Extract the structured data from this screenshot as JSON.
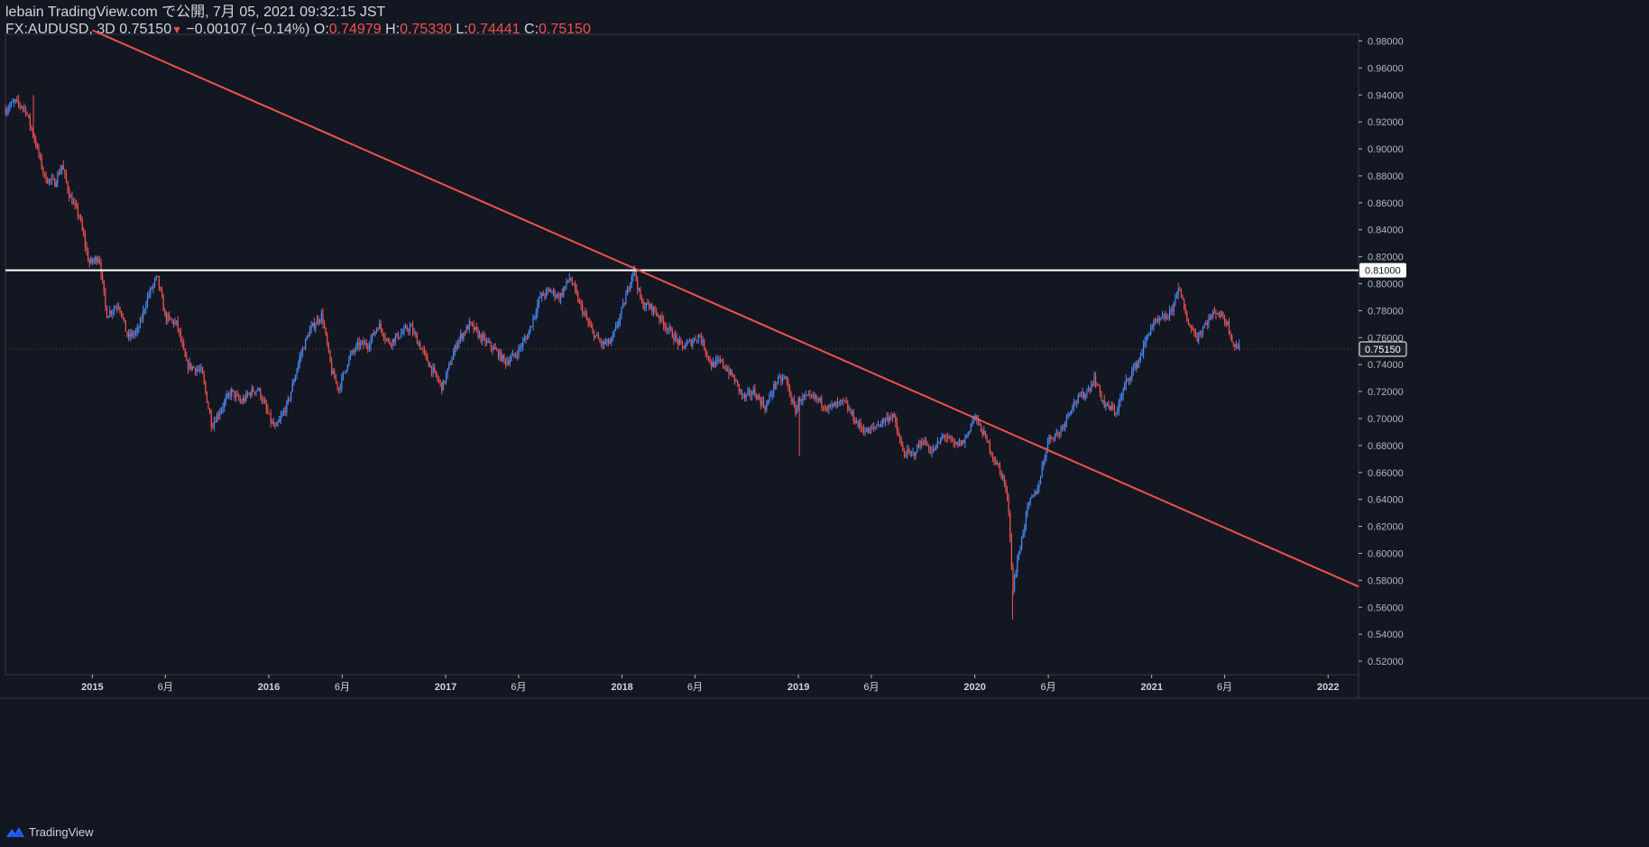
{
  "header": {
    "publish_line": "lebain TradingView.com で公開, 7月 05, 2021 09:32:15 JST",
    "symbol": "FX:AUDUSD, 3D",
    "last_price": "0.75150",
    "arrow": "▼",
    "change": "−0.00107 (−0.14%)",
    "o_label": "O:",
    "o_value": "0.74979",
    "h_label": "H:",
    "h_value": "0.75330",
    "l_label": "L:",
    "l_value": "0.74441",
    "c_label": "C:",
    "c_value": "0.75150"
  },
  "footer": {
    "brand": "TradingView",
    "logo_icon": "tradingview-logo-icon"
  },
  "colors": {
    "background": "#131722",
    "up": "#2962ff",
    "up_bright": "#4a8cf7",
    "down": "#ef5350",
    "trendline": "#f0524d",
    "level_line": "#ffffff",
    "axis_text": "#b2b5be",
    "border": "#363a45"
  },
  "chart_data": {
    "type": "candlestick",
    "title": "FX:AUDUSD, 3D",
    "ylim": [
      0.51,
      0.985
    ],
    "y_ticks": [
      "0.52000",
      "0.54000",
      "0.56000",
      "0.58000",
      "0.60000",
      "0.62000",
      "0.64000",
      "0.66000",
      "0.68000",
      "0.70000",
      "0.72000",
      "0.74000",
      "0.76000",
      "0.78000",
      "0.80000",
      "0.82000",
      "0.84000",
      "0.86000",
      "0.88000",
      "0.90000",
      "0.92000",
      "0.94000",
      "0.96000",
      "0.98000"
    ],
    "x_range": [
      "2014-07-05",
      "2022-03-05"
    ],
    "x_ticks": [
      {
        "label": "2015",
        "date": "2015-01-01",
        "bold": true
      },
      {
        "label": "6月",
        "date": "2015-06-01",
        "bold": false
      },
      {
        "label": "2016",
        "date": "2016-01-01",
        "bold": true
      },
      {
        "label": "6月",
        "date": "2016-06-01",
        "bold": false
      },
      {
        "label": "2017",
        "date": "2017-01-01",
        "bold": true
      },
      {
        "label": "6月",
        "date": "2017-06-01",
        "bold": false
      },
      {
        "label": "2018",
        "date": "2018-01-01",
        "bold": true
      },
      {
        "label": "6月",
        "date": "2018-06-01",
        "bold": false
      },
      {
        "label": "2019",
        "date": "2019-01-01",
        "bold": true
      },
      {
        "label": "6月",
        "date": "2019-06-01",
        "bold": false
      },
      {
        "label": "2020",
        "date": "2020-01-01",
        "bold": true
      },
      {
        "label": "6月",
        "date": "2020-06-01",
        "bold": false
      },
      {
        "label": "2021",
        "date": "2021-01-01",
        "bold": true
      },
      {
        "label": "6月",
        "date": "2021-06-01",
        "bold": false
      },
      {
        "label": "2022",
        "date": "2022-01-01",
        "bold": true
      }
    ],
    "price_path": [
      [
        "2014-07-05",
        0.929
      ],
      [
        "2014-07-25",
        0.935
      ],
      [
        "2014-08-15",
        0.93
      ],
      [
        "2014-09-05",
        0.905
      ],
      [
        "2014-09-25",
        0.878
      ],
      [
        "2014-10-15",
        0.875
      ],
      [
        "2014-10-30",
        0.888
      ],
      [
        "2014-11-15",
        0.865
      ],
      [
        "2014-12-05",
        0.85
      ],
      [
        "2014-12-25",
        0.815
      ],
      [
        "2015-01-15",
        0.82
      ],
      [
        "2015-01-30",
        0.777
      ],
      [
        "2015-02-25",
        0.785
      ],
      [
        "2015-03-15",
        0.76
      ],
      [
        "2015-04-05",
        0.765
      ],
      [
        "2015-04-25",
        0.79
      ],
      [
        "2015-05-15",
        0.805
      ],
      [
        "2015-06-01",
        0.775
      ],
      [
        "2015-06-25",
        0.77
      ],
      [
        "2015-07-15",
        0.74
      ],
      [
        "2015-08-15",
        0.735
      ],
      [
        "2015-09-05",
        0.695
      ],
      [
        "2015-09-25",
        0.708
      ],
      [
        "2015-10-15",
        0.72
      ],
      [
        "2015-11-05",
        0.712
      ],
      [
        "2015-11-25",
        0.72
      ],
      [
        "2015-12-10",
        0.722
      ],
      [
        "2016-01-05",
        0.698
      ],
      [
        "2016-01-15",
        0.692
      ],
      [
        "2016-02-10",
        0.712
      ],
      [
        "2016-03-05",
        0.745
      ],
      [
        "2016-03-25",
        0.765
      ],
      [
        "2016-04-20",
        0.777
      ],
      [
        "2016-05-10",
        0.735
      ],
      [
        "2016-05-25",
        0.722
      ],
      [
        "2016-06-15",
        0.745
      ],
      [
        "2016-07-05",
        0.755
      ],
      [
        "2016-07-25",
        0.755
      ],
      [
        "2016-08-15",
        0.77
      ],
      [
        "2016-09-05",
        0.756
      ],
      [
        "2016-10-01",
        0.763
      ],
      [
        "2016-10-20",
        0.768
      ],
      [
        "2016-11-10",
        0.753
      ],
      [
        "2016-12-01",
        0.738
      ],
      [
        "2016-12-25",
        0.723
      ],
      [
        "2017-01-25",
        0.757
      ],
      [
        "2017-02-20",
        0.77
      ],
      [
        "2017-03-15",
        0.76
      ],
      [
        "2017-04-10",
        0.752
      ],
      [
        "2017-05-05",
        0.742
      ],
      [
        "2017-05-25",
        0.747
      ],
      [
        "2017-06-20",
        0.762
      ],
      [
        "2017-07-15",
        0.79
      ],
      [
        "2017-08-05",
        0.795
      ],
      [
        "2017-08-25",
        0.79
      ],
      [
        "2017-09-15",
        0.805
      ],
      [
        "2017-10-05",
        0.785
      ],
      [
        "2017-10-30",
        0.765
      ],
      [
        "2017-11-20",
        0.755
      ],
      [
        "2017-12-10",
        0.757
      ],
      [
        "2018-01-05",
        0.785
      ],
      [
        "2018-01-25",
        0.812
      ],
      [
        "2018-02-10",
        0.785
      ],
      [
        "2018-03-05",
        0.782
      ],
      [
        "2018-04-05",
        0.767
      ],
      [
        "2018-05-05",
        0.753
      ],
      [
        "2018-05-25",
        0.757
      ],
      [
        "2018-06-10",
        0.762
      ],
      [
        "2018-07-05",
        0.74
      ],
      [
        "2018-07-25",
        0.742
      ],
      [
        "2018-08-20",
        0.73
      ],
      [
        "2018-09-10",
        0.715
      ],
      [
        "2018-09-30",
        0.72
      ],
      [
        "2018-10-25",
        0.708
      ],
      [
        "2018-11-15",
        0.727
      ],
      [
        "2018-12-05",
        0.73
      ],
      [
        "2018-12-25",
        0.705
      ],
      [
        "2019-01-03",
        0.715
      ],
      [
        "2019-02-05",
        0.715
      ],
      [
        "2019-03-05",
        0.708
      ],
      [
        "2019-04-05",
        0.712
      ],
      [
        "2019-05-05",
        0.695
      ],
      [
        "2019-05-25",
        0.69
      ],
      [
        "2019-06-20",
        0.697
      ],
      [
        "2019-07-15",
        0.703
      ],
      [
        "2019-08-05",
        0.675
      ],
      [
        "2019-08-25",
        0.673
      ],
      [
        "2019-09-15",
        0.684
      ],
      [
        "2019-10-05",
        0.675
      ],
      [
        "2019-10-30",
        0.688
      ],
      [
        "2019-11-20",
        0.68
      ],
      [
        "2019-12-10",
        0.683
      ],
      [
        "2019-12-31",
        0.702
      ],
      [
        "2020-01-20",
        0.688
      ],
      [
        "2020-02-10",
        0.67
      ],
      [
        "2020-03-01",
        0.655
      ],
      [
        "2020-03-12",
        0.63
      ],
      [
        "2020-03-19",
        0.573
      ],
      [
        "2020-04-01",
        0.6
      ],
      [
        "2020-04-20",
        0.635
      ],
      [
        "2020-05-10",
        0.648
      ],
      [
        "2020-06-01",
        0.685
      ],
      [
        "2020-06-25",
        0.69
      ],
      [
        "2020-07-20",
        0.71
      ],
      [
        "2020-08-20",
        0.72
      ],
      [
        "2020-09-05",
        0.73
      ],
      [
        "2020-09-25",
        0.71
      ],
      [
        "2020-10-20",
        0.705
      ],
      [
        "2020-11-10",
        0.728
      ],
      [
        "2020-12-05",
        0.743
      ],
      [
        "2020-12-30",
        0.768
      ],
      [
        "2021-01-20",
        0.773
      ],
      [
        "2021-02-10",
        0.778
      ],
      [
        "2021-02-25",
        0.798
      ],
      [
        "2021-03-15",
        0.773
      ],
      [
        "2021-04-05",
        0.76
      ],
      [
        "2021-04-25",
        0.772
      ],
      [
        "2021-05-15",
        0.78
      ],
      [
        "2021-06-05",
        0.772
      ],
      [
        "2021-06-20",
        0.755
      ],
      [
        "2021-07-03",
        0.7515
      ]
    ],
    "extremes": [
      {
        "date": "2014-09-01",
        "price": 0.94
      },
      {
        "date": "2018-01-26",
        "price": 0.8136
      },
      {
        "date": "2019-01-03",
        "price": 0.672
      },
      {
        "date": "2020-03-19",
        "price": 0.551
      },
      {
        "date": "2021-02-25",
        "price": 0.8007
      }
    ],
    "trendline": {
      "p1": {
        "date": "2015-01-01",
        "price": 0.988
      },
      "p2": {
        "date": "2022-03-01",
        "price": 0.576
      }
    },
    "horizontal_level": {
      "price": 0.81,
      "label": "0.81000"
    },
    "last_price_label": {
      "price": 0.7515,
      "label": "0.75150"
    }
  }
}
